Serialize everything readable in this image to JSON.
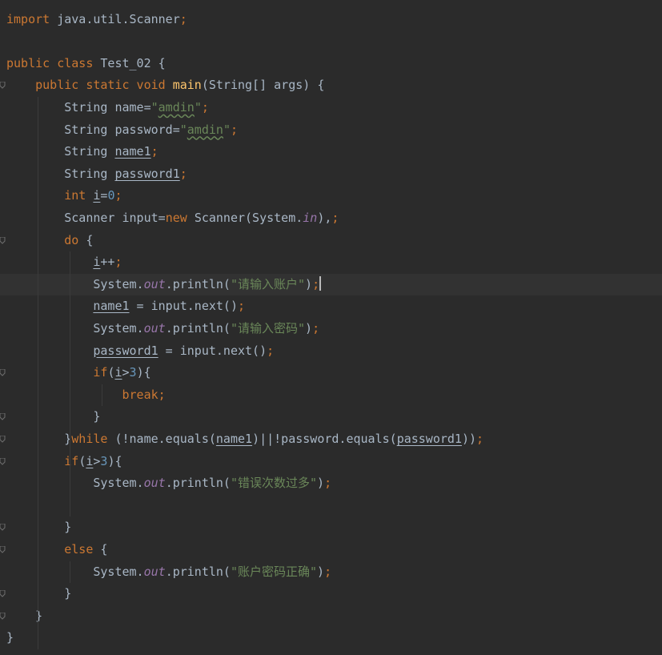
{
  "editor": {
    "current_line": 12,
    "lines": [
      [
        [
          "kw",
          "import "
        ],
        [
          "",
          "java.util.Scanner"
        ],
        [
          "pun",
          ";"
        ]
      ],
      [],
      [
        [
          "kw",
          "public class "
        ],
        [
          "",
          "Test_02 {"
        ]
      ],
      [
        [
          "",
          "    "
        ],
        [
          "kw",
          "public static void "
        ],
        [
          "fn",
          "main"
        ],
        [
          "",
          "(String[] args) {"
        ]
      ],
      [
        [
          "",
          "        String name="
        ],
        [
          "str",
          "\""
        ],
        [
          "str typo",
          "amdin"
        ],
        [
          "str",
          "\""
        ],
        [
          "pun",
          ";"
        ]
      ],
      [
        [
          "",
          "        String password="
        ],
        [
          "str",
          "\""
        ],
        [
          "str typo",
          "amdin"
        ],
        [
          "str",
          "\""
        ],
        [
          "pun",
          ";"
        ]
      ],
      [
        [
          "",
          "        String "
        ],
        [
          "var",
          "name1"
        ],
        [
          "pun",
          ";"
        ]
      ],
      [
        [
          "",
          "        String "
        ],
        [
          "var",
          "password1"
        ],
        [
          "pun",
          ";"
        ]
      ],
      [
        [
          "",
          "        "
        ],
        [
          "kw",
          "int "
        ],
        [
          "var",
          "i"
        ],
        [
          "",
          "="
        ],
        [
          "num",
          "0"
        ],
        [
          "pun",
          ";"
        ]
      ],
      [
        [
          "",
          "        Scanner input="
        ],
        [
          "kw",
          "new "
        ],
        [
          "",
          "Scanner(System."
        ],
        [
          "fld",
          "in"
        ],
        [
          "",
          "),"
        ],
        [
          "pun",
          ";"
        ]
      ],
      [
        [
          "",
          "        "
        ],
        [
          "kw",
          "do "
        ],
        [
          "",
          "{"
        ]
      ],
      [
        [
          "",
          "            "
        ],
        [
          "var",
          "i"
        ],
        [
          "",
          "++"
        ],
        [
          "pun",
          ";"
        ]
      ],
      [
        [
          "",
          "            System."
        ],
        [
          "fld",
          "out"
        ],
        [
          "",
          ".println("
        ],
        [
          "str",
          "\"请输入账户\""
        ],
        [
          "",
          ")"
        ],
        [
          "pun",
          ";"
        ],
        [
          "caret",
          ""
        ]
      ],
      [
        [
          "",
          "            "
        ],
        [
          "var",
          "name1"
        ],
        [
          "",
          " = input.next()"
        ],
        [
          "pun",
          ";"
        ]
      ],
      [
        [
          "",
          "            System."
        ],
        [
          "fld",
          "out"
        ],
        [
          "",
          ".println("
        ],
        [
          "str",
          "\"请输入密码\""
        ],
        [
          "",
          ")"
        ],
        [
          "pun",
          ";"
        ]
      ],
      [
        [
          "",
          "            "
        ],
        [
          "var",
          "password1"
        ],
        [
          "",
          " = input.next()"
        ],
        [
          "pun",
          ";"
        ]
      ],
      [
        [
          "",
          "            "
        ],
        [
          "kw",
          "if"
        ],
        [
          "",
          "("
        ],
        [
          "var",
          "i"
        ],
        [
          "",
          ">"
        ],
        [
          "num",
          "3"
        ],
        [
          "",
          "){"
        ]
      ],
      [
        [
          "",
          "                "
        ],
        [
          "kw",
          "break"
        ],
        [
          "pun",
          ";"
        ]
      ],
      [
        [
          "",
          "            }"
        ]
      ],
      [
        [
          "",
          "        }"
        ],
        [
          "kw",
          "while "
        ],
        [
          "",
          "(!name.equals("
        ],
        [
          "var",
          "name1"
        ],
        [
          "",
          ")||!password.equals("
        ],
        [
          "var",
          "password1"
        ],
        [
          "",
          "))"
        ],
        [
          "pun",
          ";"
        ]
      ],
      [
        [
          "",
          "        "
        ],
        [
          "kw",
          "if"
        ],
        [
          "",
          "("
        ],
        [
          "var",
          "i"
        ],
        [
          "",
          ">"
        ],
        [
          "num",
          "3"
        ],
        [
          "",
          "){"
        ]
      ],
      [
        [
          "",
          "            System."
        ],
        [
          "fld",
          "out"
        ],
        [
          "",
          ".println("
        ],
        [
          "str",
          "\"错误次数过多\""
        ],
        [
          "",
          ")"
        ],
        [
          "pun",
          ";"
        ]
      ],
      [],
      [
        [
          "",
          "        }"
        ]
      ],
      [
        [
          "",
          "        "
        ],
        [
          "kw",
          "else "
        ],
        [
          "",
          "{"
        ]
      ],
      [
        [
          "",
          "            System."
        ],
        [
          "fld",
          "out"
        ],
        [
          "",
          ".println("
        ],
        [
          "str",
          "\"账户密码正确\""
        ],
        [
          "",
          ")"
        ],
        [
          "pun",
          ";"
        ]
      ],
      [
        [
          "",
          "        }"
        ]
      ],
      [
        [
          "",
          "    }"
        ]
      ],
      [
        [
          "",
          "}"
        ]
      ]
    ],
    "fold_markers": [
      3,
      10,
      16,
      18,
      19,
      20,
      23,
      24,
      26,
      27
    ]
  }
}
